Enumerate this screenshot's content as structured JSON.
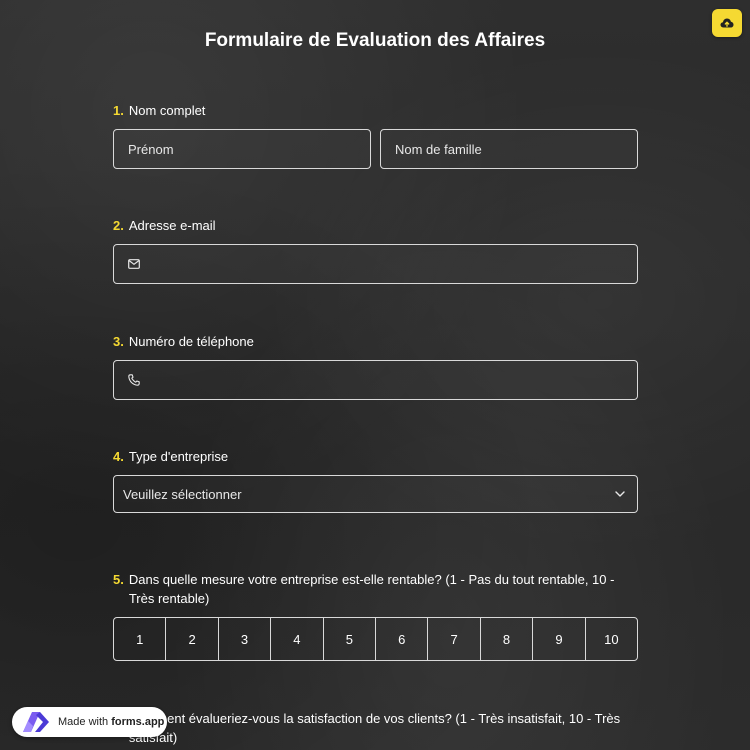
{
  "form": {
    "title": "Formulaire de Evaluation des Affaires"
  },
  "questions": [
    {
      "number": "1.",
      "label": "Nom complet",
      "first_placeholder": "Prénom",
      "last_placeholder": "Nom de famille"
    },
    {
      "number": "2.",
      "label": "Adresse e-mail",
      "icon": "mail-icon"
    },
    {
      "number": "3.",
      "label": "Numéro de téléphone",
      "icon": "phone-icon"
    },
    {
      "number": "4.",
      "label": "Type d'entreprise",
      "select_value": "Veuillez sélectionner"
    },
    {
      "number": "5.",
      "label": "Dans quelle mesure votre entreprise est-elle rentable? (1 - Pas du tout rentable, 10 - Très rentable)",
      "scale": [
        "1",
        "2",
        "3",
        "4",
        "5",
        "6",
        "7",
        "8",
        "9",
        "10"
      ]
    },
    {
      "number": "6.",
      "label": "Comment évalueriez-vous la satisfaction de vos clients? (1 - Très insatisfait, 10 - Très satisfait)"
    }
  ],
  "badge": {
    "prefix": "Made with ",
    "brand": "forms.app"
  },
  "colors": {
    "accent": "#f5d932",
    "background": "#2b2b2b",
    "border": "#d9d9d9"
  }
}
